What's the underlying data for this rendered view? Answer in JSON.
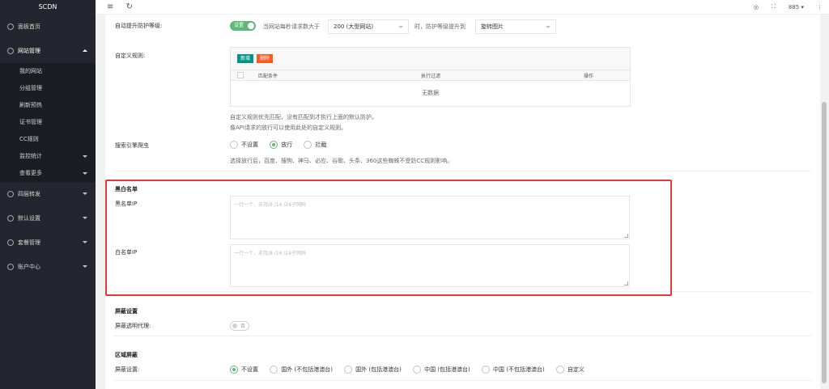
{
  "app": {
    "brand": "SCDN"
  },
  "sidebar": {
    "items": [
      {
        "label": "面板首页"
      },
      {
        "label": "网站管理",
        "open": true
      },
      {
        "label": "四层转发"
      },
      {
        "label": "默认设置"
      },
      {
        "label": "套餐管理"
      },
      {
        "label": "账户中心"
      }
    ],
    "sub_items": [
      {
        "label": "我的网站"
      },
      {
        "label": "分组管理"
      },
      {
        "label": "刷新预热"
      },
      {
        "label": "证书管理"
      },
      {
        "label": "CC规则"
      },
      {
        "label": "监控统计",
        "expandable": true
      },
      {
        "label": "查看更多",
        "expandable": true
      }
    ]
  },
  "topbar": {
    "menu_icon": "≡",
    "refresh_icon": "↻",
    "user": "885",
    "skin_icon": "◎",
    "fullscreen_icon": "⛶",
    "more_icon": "⋮"
  },
  "auto_protect": {
    "label": "自动提升防护等级:",
    "toggle_label": "设置",
    "text_before": "当网站每秒请求数大于",
    "threshold_value": "200 (大型网站)",
    "text_after": "时，防护等级提升到",
    "level_value": "旋转图片"
  },
  "custom_rules": {
    "label": "自定义规则:",
    "add_button": "新增",
    "delete_button": "删除",
    "columns": [
      "匹配条件",
      "执行过滤",
      "操作"
    ],
    "empty_text": "无数据",
    "note1": "自定义规则优先匹配，没有匹配到才执行上面的默认防护。",
    "note2": "像API请求的放行可以使用此处的自定义规则。"
  },
  "search_spider": {
    "label": "搜索引擎爬虫",
    "options": [
      "不设置",
      "放行",
      "拦截"
    ],
    "selected": "放行",
    "note": "选择放行后，百度、搜狗、神马、必应、谷歌、头条、360这些蜘蛛不受防CC规则影响。"
  },
  "blackwhite": {
    "title": "黑白名单",
    "black_label": "黑名单IP",
    "black_placeholder": "一行一个，支持/8 /16 /24子网码",
    "white_label": "白名单IP",
    "white_placeholder": "一行一个，支持/8 /16 /24子网码"
  },
  "shield": {
    "title": "屏蔽设置",
    "proxy_label": "屏蔽透明代理:",
    "proxy_toggle": "否"
  },
  "region": {
    "title": "区域屏蔽",
    "label": "屏蔽设置:",
    "options": [
      "不设置",
      "国外 (不包括港澳台)",
      "国外 (包括港澳台)",
      "中国 (包括港澳台)",
      "中国 (不包括港澳台)",
      "自定义"
    ],
    "selected": "不设置"
  },
  "colors": {
    "accent": "#5fb878",
    "sidebar_bg": "#23262e",
    "highlight": "#e53935"
  }
}
